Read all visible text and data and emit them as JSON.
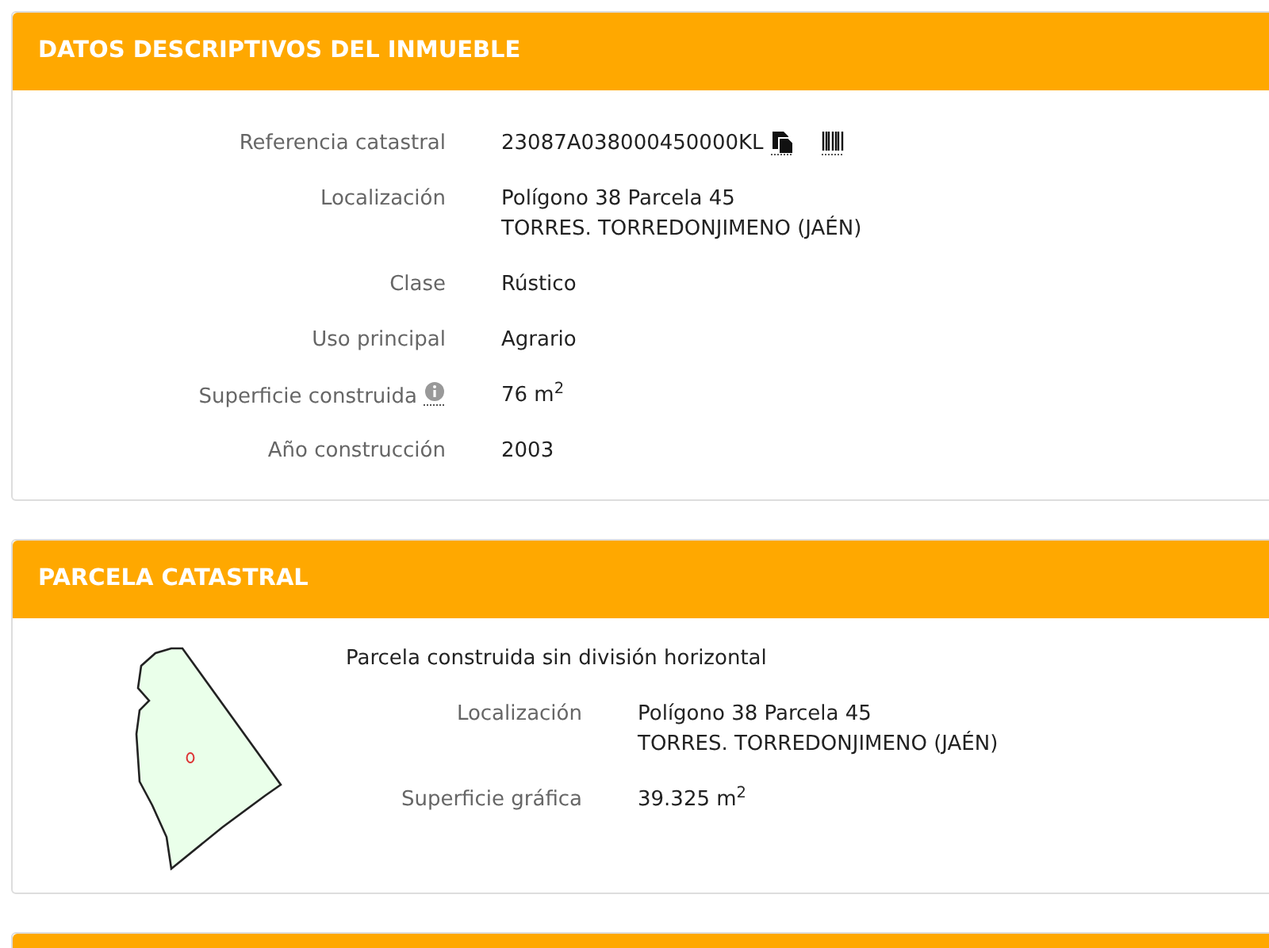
{
  "property_panel": {
    "title": "DATOS DESCRIPTIVOS DEL INMUEBLE",
    "fields": [
      {
        "label": "Referencia catastral",
        "lines": [
          "23087A038000450000KL"
        ],
        "kind": "reference"
      },
      {
        "label": "Localización",
        "lines": [
          "Polígono 38 Parcela 45",
          "TORRES. TORREDONJIMENO (JAÉN)"
        ],
        "kind": "text"
      },
      {
        "label": "Clase",
        "lines": [
          "Rústico"
        ],
        "kind": "text"
      },
      {
        "label": "Uso principal",
        "lines": [
          "Agrario"
        ],
        "kind": "text"
      },
      {
        "label": "Superficie construida",
        "lines": [
          "76 m$^{2}$"
        ],
        "kind": "info"
      },
      {
        "label": "Año construcción",
        "lines": [
          "2003"
        ],
        "kind": "text"
      }
    ]
  },
  "parcel_panel": {
    "title": "PARCELA CATASTRAL",
    "subtitle": "Parcela construida sin división horizontal",
    "fields": [
      {
        "label": "Localización",
        "lines": [
          "Polígono 38 Parcela 45",
          "TORRES. TORREDONJIMENO (JAÉN)"
        ]
      },
      {
        "label": "Superficie gráfica",
        "lines": [
          "39.325 m$^{2}$"
        ]
      }
    ]
  }
}
